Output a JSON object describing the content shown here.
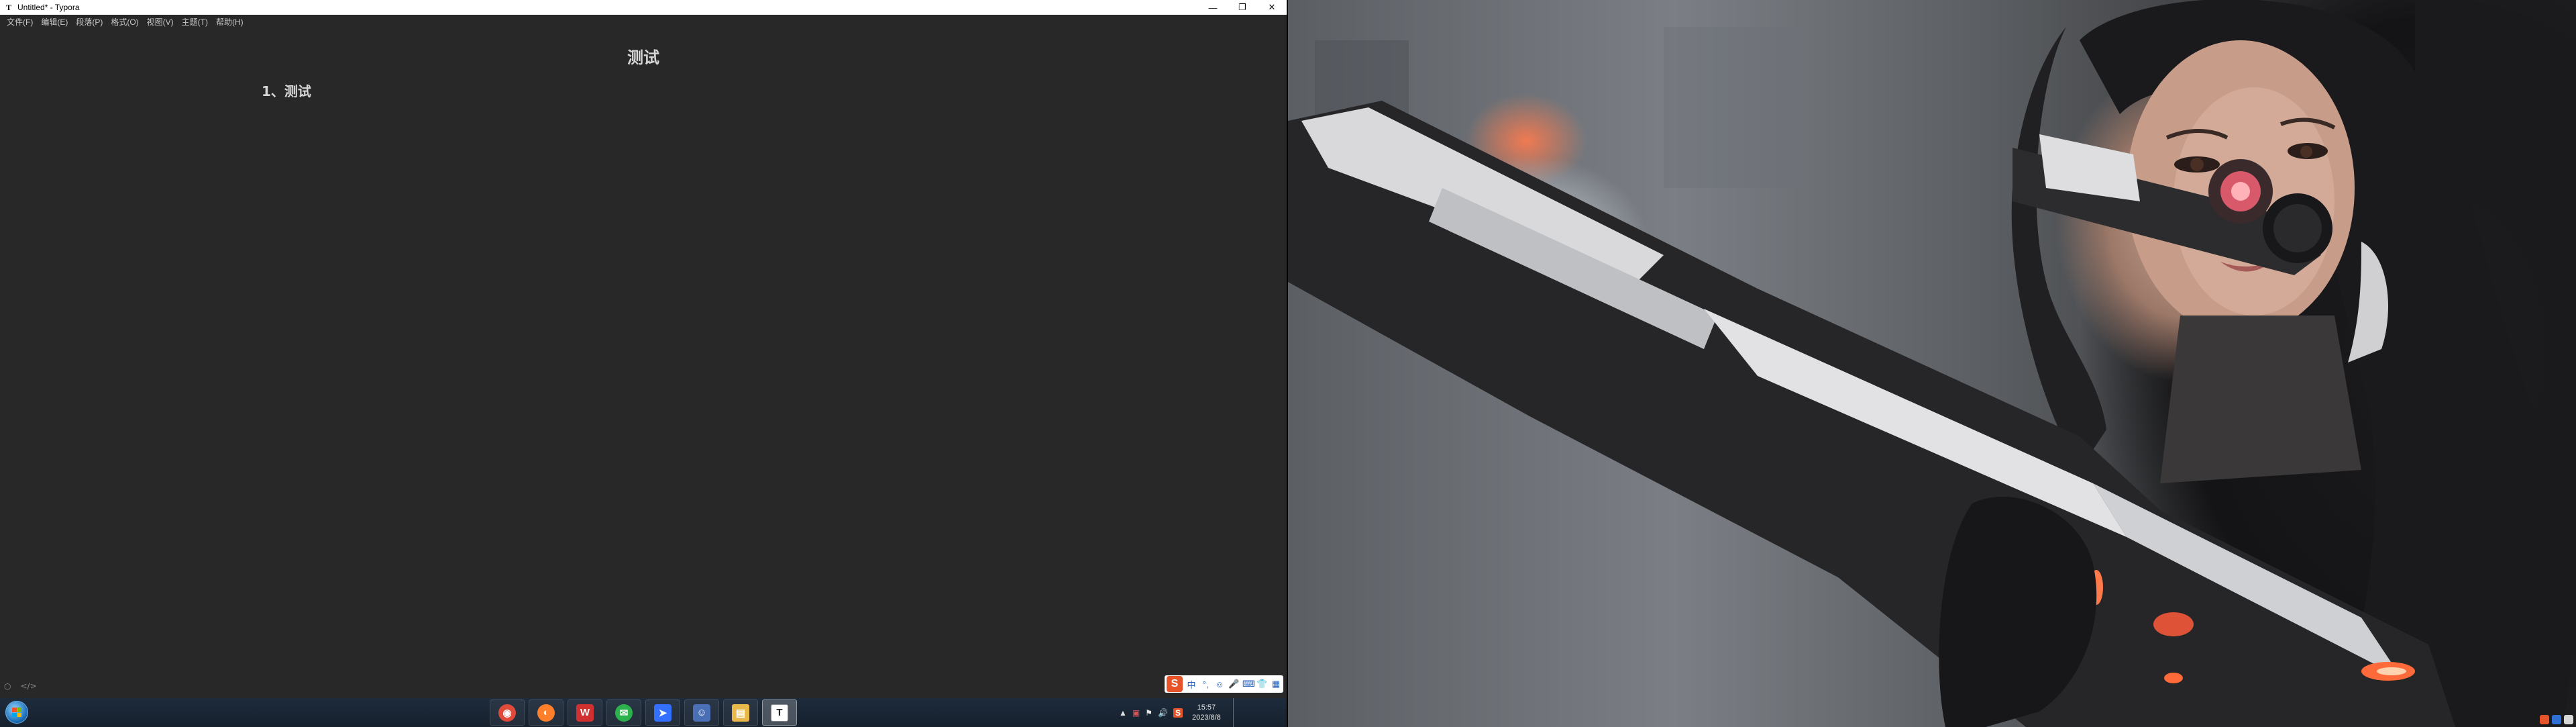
{
  "window": {
    "title": "Untitled* - Typora",
    "app_icon": "T",
    "controls": [
      "—",
      "❐",
      "✕"
    ]
  },
  "menubar": [
    "文件(F)",
    "编辑(E)",
    "段落(P)",
    "格式(O)",
    "视图(V)",
    "主题(T)",
    "帮助(H)"
  ],
  "document": {
    "title": "测试",
    "heading": "1、测试"
  },
  "statusbar": {
    "outline_icon": "○",
    "source_icon": "</>"
  },
  "ime_bar": {
    "logo": "S",
    "items": [
      "中",
      "°,",
      "☺",
      "🎤",
      "⌨",
      "👕",
      "▦"
    ]
  },
  "taskbar": {
    "pinned": [
      {
        "name": "chrome",
        "glyph": "◉",
        "color": "#e04a3a"
      },
      {
        "name": "firefox",
        "glyph": "◐",
        "color": "#ff7f2a"
      },
      {
        "name": "wps",
        "glyph": "W",
        "color": "#d0302f"
      },
      {
        "name": "wechat",
        "glyph": "✉",
        "color": "#2bb24c"
      },
      {
        "name": "feishu",
        "glyph": "➤",
        "color": "#3370ff"
      },
      {
        "name": "person-app",
        "glyph": "☺",
        "color": "#4a6fb5"
      },
      {
        "name": "file-explorer",
        "glyph": "▤",
        "color": "#e8b84a"
      },
      {
        "name": "typora",
        "glyph": "T",
        "color": "#3a3a3a"
      }
    ],
    "tray_icons": [
      "▲",
      "▣",
      "⚑",
      "🔊",
      "S"
    ],
    "clock": {
      "time": "15:57",
      "date": "2023/8/8"
    }
  }
}
